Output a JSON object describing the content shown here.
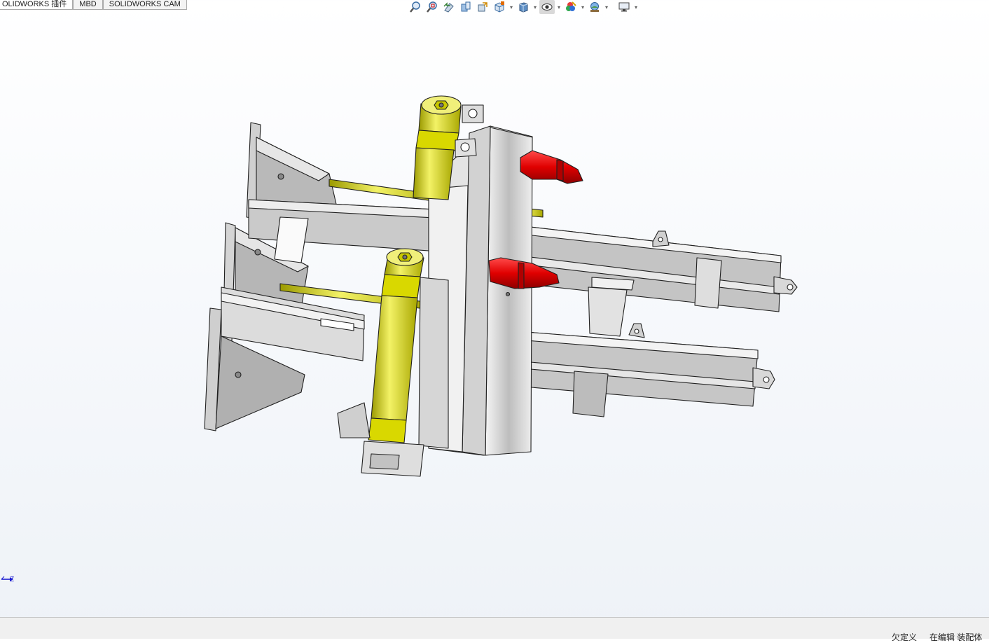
{
  "command_manager": {
    "tabs": [
      {
        "label": "OLIDWORKS 插件"
      },
      {
        "label": "MBD"
      },
      {
        "label": "SOLIDWORKS CAM"
      }
    ]
  },
  "heads_up_toolbar": {
    "items": [
      {
        "icon": "zoom-to-fit-icon"
      },
      {
        "icon": "zoom-to-area-icon"
      },
      {
        "icon": "previous-view-icon"
      },
      {
        "icon": "section-view-icon"
      },
      {
        "icon": "dynamic-annotation-views-icon"
      },
      {
        "icon": "view-orientation-icon"
      },
      {
        "icon": "display-style-icon"
      },
      {
        "icon": "hide-show-items-icon"
      },
      {
        "icon": "edit-appearance-icon"
      },
      {
        "icon": "apply-scene-icon"
      },
      {
        "icon": "view-settings-icon"
      }
    ]
  },
  "triad": {
    "axis_label": "Z"
  },
  "status_bar": {
    "definition": "欠定义",
    "mode": "在编辑 装配体"
  },
  "colors": {
    "cylinder_yellow": "#e8e600",
    "fitting_red": "#e00000",
    "frame_gray": "#b8b8b8",
    "edge_dark": "#202020"
  }
}
